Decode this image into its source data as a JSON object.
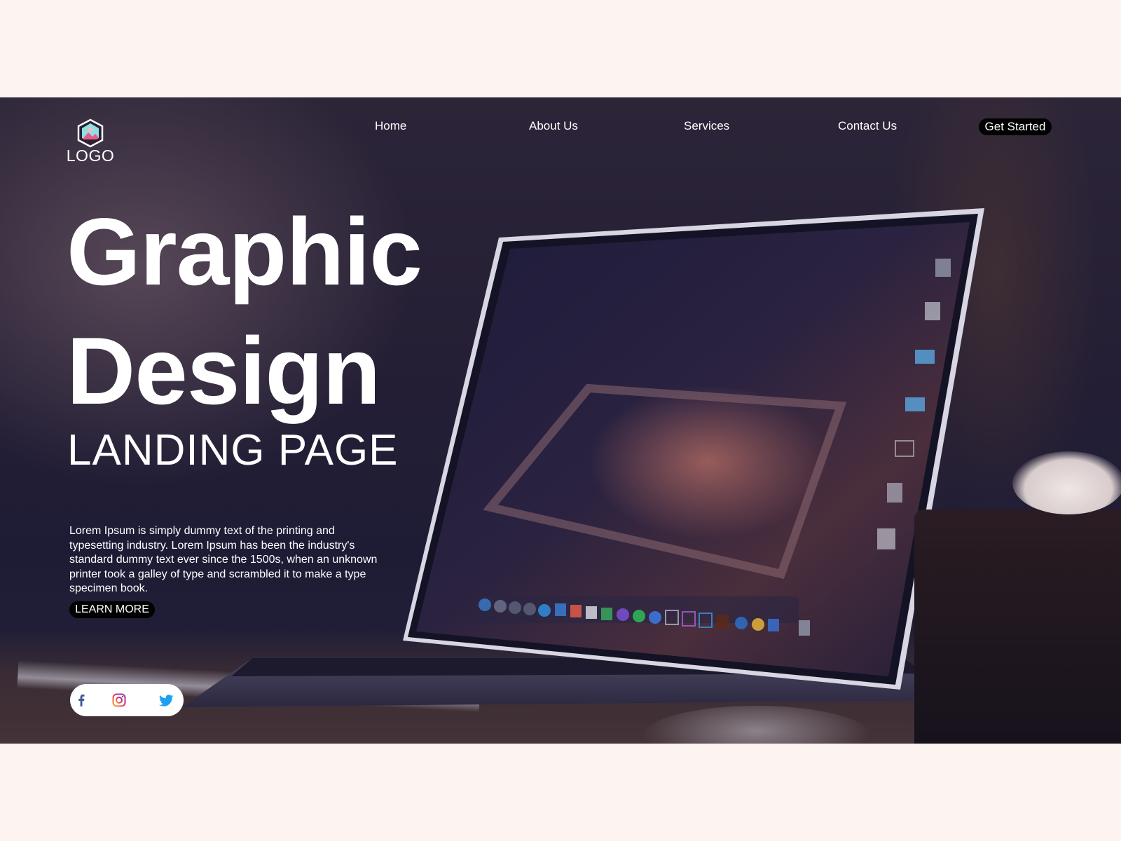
{
  "logo": {
    "text": "LOGO",
    "icon": "image-icon"
  },
  "nav": {
    "items": [
      {
        "label": "Home"
      },
      {
        "label": "About Us"
      },
      {
        "label": "Services"
      },
      {
        "label": "Contact Us"
      }
    ],
    "cta_label": "Get Started"
  },
  "hero": {
    "title_line1": "Graphic",
    "title_line2": "Design",
    "subtitle": "LANDING PAGE",
    "body": "Lorem Ipsum is simply dummy text of the printing and typesetting industry. Lorem Ipsum has been the industry's standard dummy text ever since the 1500s, when an unknown printer took a galley of type and scrambled it to make a type specimen book.",
    "learn_more_label": "LEARN MORE"
  },
  "social": {
    "icons": [
      "facebook-icon",
      "instagram-icon",
      "twitter-icon"
    ]
  },
  "colors": {
    "page_bg": "#fdf3f1",
    "button_bg": "#000000",
    "text": "#ffffff",
    "facebook": "#3b5998",
    "twitter": "#1da1f2"
  }
}
